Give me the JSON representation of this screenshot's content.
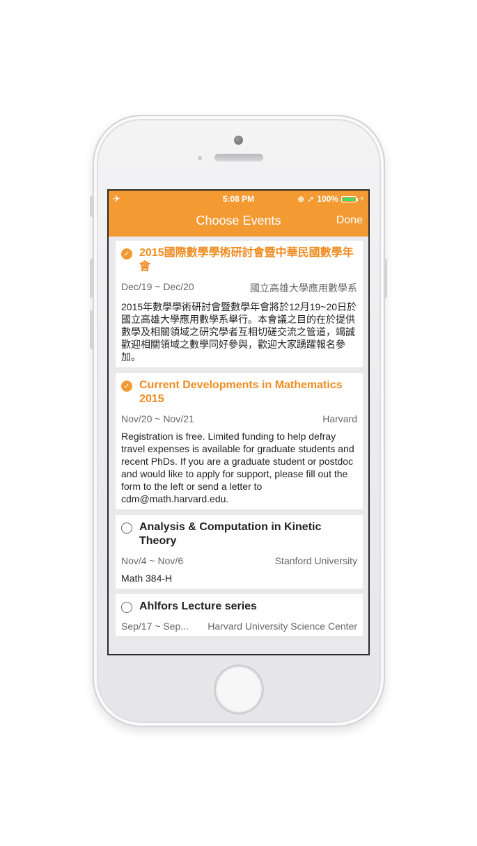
{
  "status_bar": {
    "time": "5:08 PM",
    "battery": "100%",
    "icons": [
      "airplane-icon",
      "lock-rotation-icon",
      "location-arrow-icon",
      "battery-icon",
      "charging-bolt-icon"
    ]
  },
  "navbar": {
    "title": "Choose Events",
    "done_label": "Done"
  },
  "colors": {
    "accent": "#f39a33",
    "selected_title": "#ef8b1f"
  },
  "events": [
    {
      "selected": true,
      "title": "2015國際數學學術研討會暨中華民國數學年會",
      "dates": "Dec/19 ~ Dec/20",
      "location": "國立高雄大學應用數學系",
      "description": "2015年數學學術研討會暨數學年會將於12月19~20日於國立高雄大學應用數學系舉行。本會議之目的在於提供數學及相關領域之研究學者互相切磋交流之管道，竭誠歡迎相關領域之數學同好參與，歡迎大家踴躍報名參加。"
    },
    {
      "selected": true,
      "title": "Current Developments in Mathematics 2015",
      "dates": "Nov/20 ~ Nov/21",
      "location": "Harvard",
      "description": "Registration is free. Limited funding to help defray travel expenses is available for graduate students and recent PhDs. If you are a graduate student or postdoc and would like to apply for support, please fill out the form to the left or send a letter to cdm@math.harvard.edu."
    },
    {
      "selected": false,
      "title": "Analysis & Computation in Kinetic Theory",
      "dates": "Nov/4 ~ Nov/6",
      "location": "Stanford University",
      "description": "Math 384-H"
    },
    {
      "selected": false,
      "title": "Ahlfors Lecture series",
      "dates": "Sep/17 ~ Sep...",
      "location": "Harvard University Science Center",
      "description": ""
    }
  ]
}
